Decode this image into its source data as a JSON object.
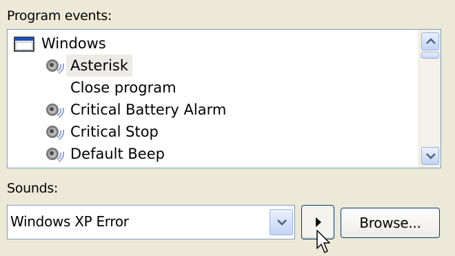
{
  "program_events": {
    "label": "Program events:",
    "items": [
      {
        "label": "Windows",
        "icon": "window-icon",
        "selected": false
      },
      {
        "label": "Asterisk",
        "icon": "speaker-icon",
        "selected": true
      },
      {
        "label": "Close program",
        "icon": "none",
        "selected": false
      },
      {
        "label": "Critical Battery Alarm",
        "icon": "speaker-icon",
        "selected": false
      },
      {
        "label": "Critical Stop",
        "icon": "speaker-icon",
        "selected": false
      },
      {
        "label": "Default Beep",
        "icon": "speaker-icon",
        "selected": false
      }
    ]
  },
  "sounds": {
    "label": "Sounds:",
    "selected_value": "Windows XP Error"
  },
  "buttons": {
    "play_icon": "play-icon",
    "browse_label": "Browse..."
  },
  "colors": {
    "dialog_background": "#ece9d8",
    "list_border": "#7f9db9",
    "button_border": "#003c74",
    "selection_highlight": "#ecebe6"
  }
}
